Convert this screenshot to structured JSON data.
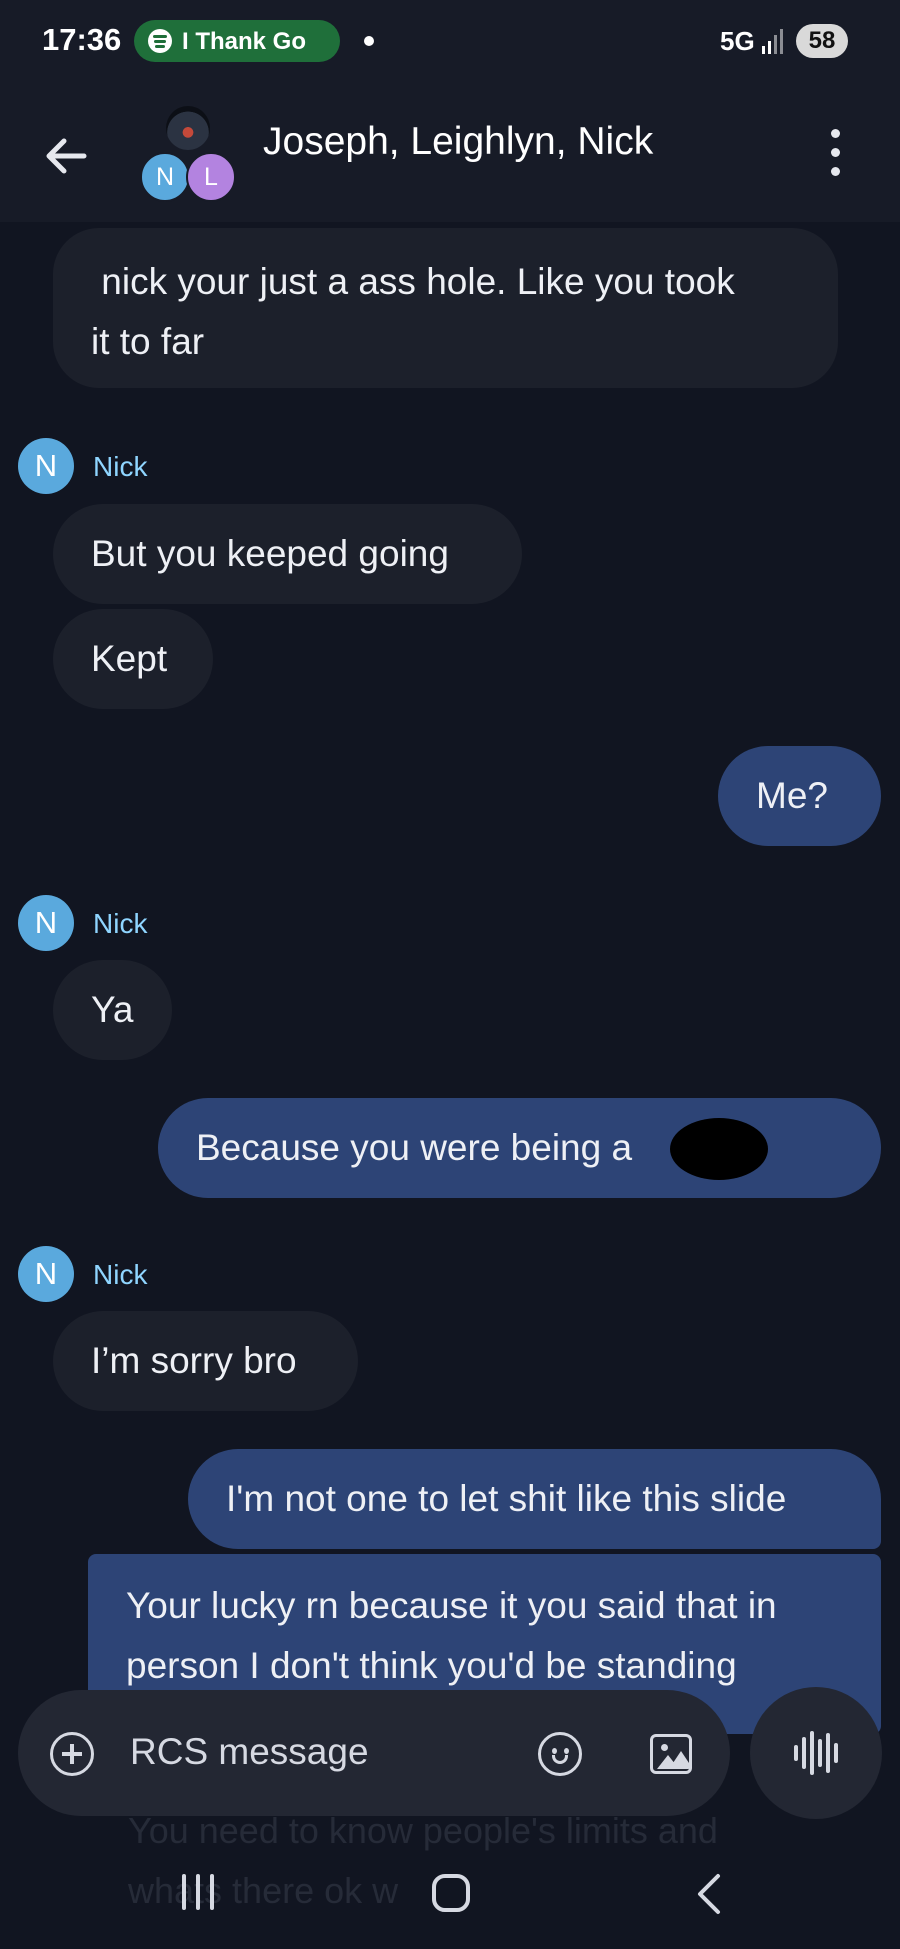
{
  "status_bar": {
    "time": "17:36",
    "media_text": "I Thank Go",
    "network": "5G",
    "battery": "58"
  },
  "header": {
    "title": "Joseph, Leighlyn, Nick",
    "avatar_letters": [
      "N",
      "L"
    ]
  },
  "messages": [
    {
      "type": "incoming",
      "text": " nick your just a ass hole. Like you took\nit to far"
    },
    {
      "type": "sender",
      "name": "Nick",
      "initial": "N"
    },
    {
      "type": "incoming",
      "text": "But you keeped going"
    },
    {
      "type": "incoming",
      "text": "Kept"
    },
    {
      "type": "outgoing",
      "text": "Me?"
    },
    {
      "type": "sender",
      "name": "Nick",
      "initial": "N"
    },
    {
      "type": "incoming",
      "text": "Ya"
    },
    {
      "type": "outgoing",
      "text": "Because you were being a        bro"
    },
    {
      "type": "sender",
      "name": "Nick",
      "initial": "N"
    },
    {
      "type": "incoming",
      "text": "I’m sorry bro"
    },
    {
      "type": "outgoing",
      "text": "I'm not one to let shit like this slide"
    },
    {
      "type": "outgoing",
      "text": "Your lucky rn because it you said that in\nperson I don't think you'd be standing"
    }
  ],
  "composer": {
    "placeholder": "RCS message",
    "hidden_preview_1": "You need to know people's limits and",
    "hidden_preview_2": "whats there ok w"
  },
  "colors": {
    "background": "#111521",
    "incoming_bubble": "#1c202b",
    "outgoing_bubble": "#2d4476",
    "sender_name": "#8fd5ff",
    "spotify_green": "#1f6f3a"
  },
  "icons": [
    "back-arrow-icon",
    "more-vert-icon",
    "add-circle-icon",
    "emoji-icon",
    "image-icon",
    "voice-icon",
    "spotify-icon"
  ]
}
